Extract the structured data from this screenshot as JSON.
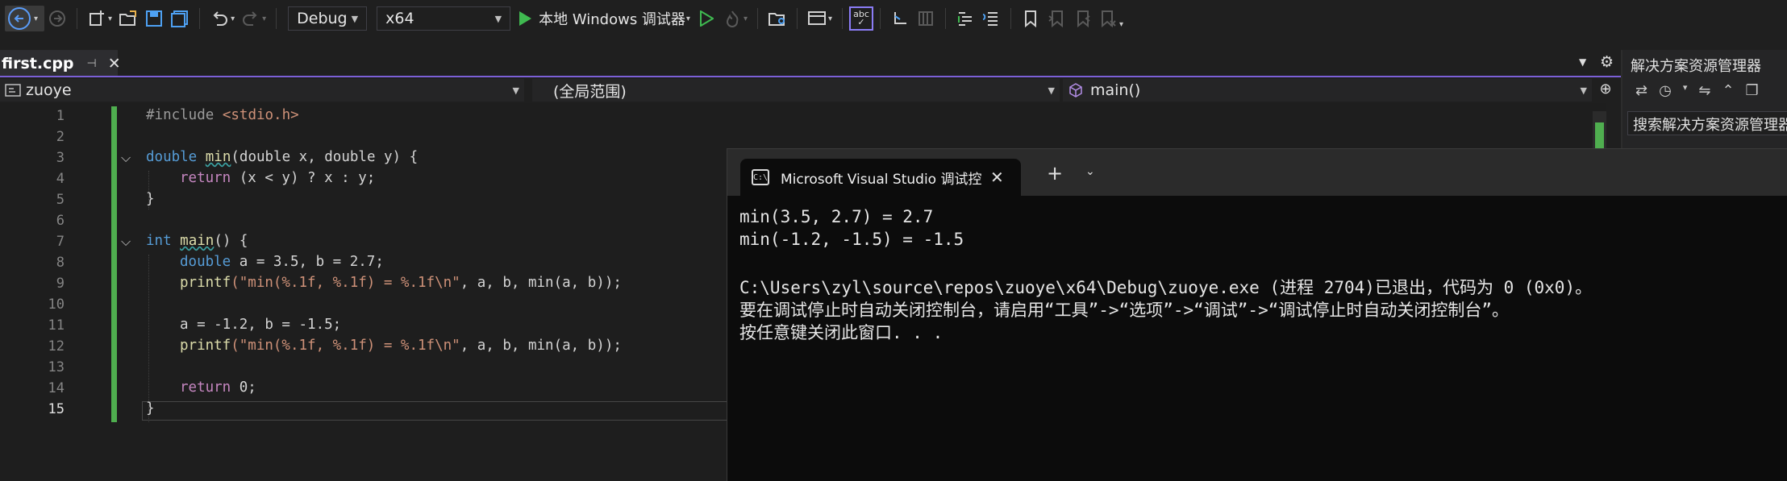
{
  "toolbar": {
    "configuration": "Debug",
    "platform": "x64",
    "run_label": "本地 Windows 调试器",
    "spell_icon_text": "abc"
  },
  "tabs": [
    {
      "label": "first.cpp",
      "active": true
    }
  ],
  "navbar": {
    "project": "zuoye",
    "scope": "(全局范围)",
    "member": "main()"
  },
  "editor": {
    "line_numbers": [
      "1",
      "2",
      "3",
      "4",
      "5",
      "6",
      "7",
      "8",
      "9",
      "10",
      "11",
      "12",
      "13",
      "14",
      "15"
    ],
    "current_line": "15",
    "code": {
      "l1_directive": "#include",
      "l1_header": " <stdio.h>",
      "l3_type": "double",
      "l3_name": "min",
      "l3_params": "(double x, double y) {",
      "l4_return": "return",
      "l4_expr": " (x < y) ? x : y;",
      "l5": "}",
      "l7_type": "int",
      "l7_name": "main",
      "l7_rest": "() {",
      "l8_type": "double",
      "l8_rest": " a = 3.5, b = 2.7;",
      "l9_fn": "printf",
      "l9_str": "(\"min(%.1f, %.1f) = %.1f\\n\"",
      "l9_rest": ", a, b, min(a, b));",
      "l11": "a = -1.2, b = -1.5;",
      "l12_fn": "printf",
      "l12_str": "(\"min(%.1f, %.1f) = %.1f\\n\"",
      "l12_rest": ", a, b, min(a, b));",
      "l14_return": "return",
      "l14_rest": " 0;",
      "l15": "}"
    }
  },
  "solution_explorer": {
    "title": "解决方案资源管理器",
    "search_placeholder": "搜索解决方案资源管理器"
  },
  "console": {
    "tab_title": "Microsoft Visual Studio 调试控",
    "output_lines": [
      "min(3.5, 2.7) = 2.7",
      "min(-1.2, -1.5) = -1.5",
      "",
      "C:\\Users\\zyl\\source\\repos\\zuoye\\x64\\Debug\\zuoye.exe (进程 2704)已退出，代码为 0 (0x0)。",
      "要在调试停止时自动关闭控制台，请启用“工具”->“选项”->“调试”->“调试停止时自动关闭控制台”。",
      "按任意键关闭此窗口. . ."
    ]
  },
  "colors": {
    "accent": "#7b5fd6",
    "change_bar": "#4fae4f",
    "run_green": "#3fb950",
    "keyword": "#569cd6",
    "function": "#dcdcaa"
  }
}
